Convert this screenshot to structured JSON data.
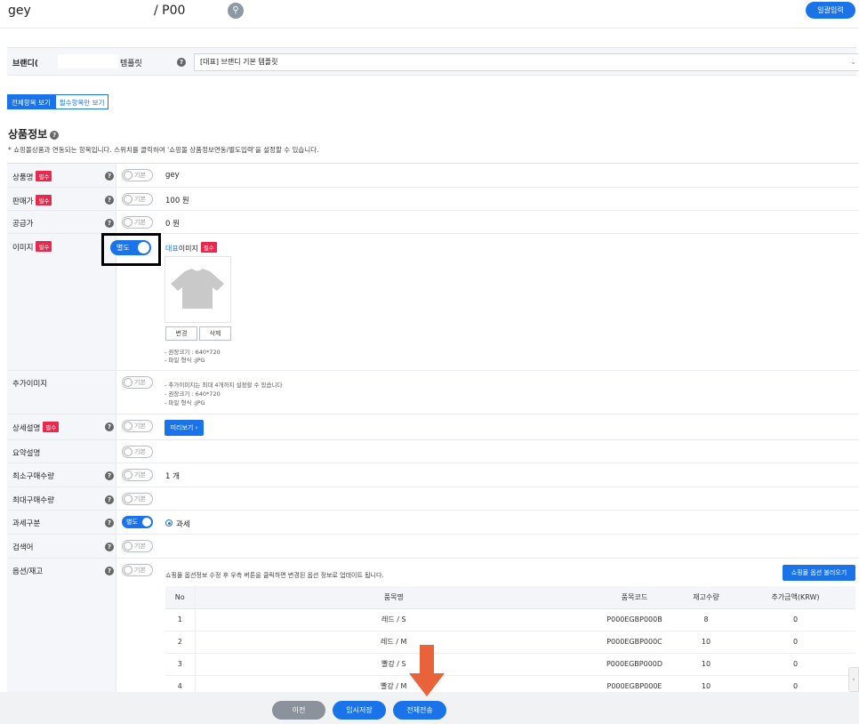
{
  "header": {
    "product_name": "gey",
    "product_code": "/ P00",
    "bulk_input_label": "일괄입력"
  },
  "brand_row": {
    "brand_label": "브랜디(",
    "template_label": "템플릿",
    "template_selected": "[대표] 브랜디 기본 템플릿"
  },
  "view_tabs": {
    "all_label": "전체항목 보기",
    "required_label": "필수항목만 보기"
  },
  "section": {
    "title": "상품정보",
    "description": "* 쇼핑몰상품과 연동되는 항목입니다. 스위치를 클릭하여 '쇼핑몰 상품정보연동/별도입력'을 설정할 수 있습니다."
  },
  "labels": {
    "required": "필수",
    "toggle_default": "기본",
    "toggle_separate": "별도"
  },
  "rows": {
    "product_name": {
      "label": "상품명",
      "value": "gey"
    },
    "sale_price": {
      "label": "판매가",
      "value": "100 원"
    },
    "supply_price": {
      "label": "공급가",
      "value": "0 원"
    },
    "image": {
      "label": "이미지",
      "rep_prefix": "대표",
      "rep_suffix": "이미지",
      "change_btn": "변경",
      "delete_btn": "삭제",
      "note_size": "- 권장크기 : 640*720",
      "note_format": "- 파일 형식 :JPG"
    },
    "extra_image": {
      "label": "추가이미지",
      "note_max": "- 추가이미지는 최대 4개까지 설정할 수 있습니다",
      "note_size": "- 권장크기 : 640*720",
      "note_format": "- 파일 형식 :JPG"
    },
    "detail_desc": {
      "label": "상세설명",
      "preview_btn": "미리보기 ›"
    },
    "summary_desc": {
      "label": "요약설명"
    },
    "min_qty": {
      "label": "최소구매수량",
      "value": "1 개"
    },
    "max_qty": {
      "label": "최대구매수량"
    },
    "tax": {
      "label": "과세구분",
      "option": "과세"
    },
    "keyword": {
      "label": "검색어"
    },
    "option_stock": {
      "label": "옵션/재고",
      "description": "쇼핑몰 옵션정보 수정 후 우측 버튼을 클릭하면 변경된 옵션 정보로 업데이트 됩니다.",
      "load_btn": "쇼핑몰 옵션 불러오기",
      "columns": [
        "No",
        "품목명",
        "품목코드",
        "재고수량",
        "추가금액(KRW)"
      ],
      "items": [
        {
          "no": "1",
          "name": "레드 / S",
          "code": "P000EGBP000B",
          "stock": "8",
          "extra": "0"
        },
        {
          "no": "2",
          "name": "레드 / M",
          "code": "P000EGBP000C",
          "stock": "10",
          "extra": "0"
        },
        {
          "no": "3",
          "name": "빨강 / S",
          "code": "P000EGBP000D",
          "stock": "10",
          "extra": "0"
        },
        {
          "no": "4",
          "name": "빨강 / M",
          "code": "P000EGBP000E",
          "stock": "10",
          "extra": "0"
        }
      ]
    }
  },
  "footer": {
    "prev_btn": "이전",
    "temp_save_btn": "임시저장",
    "send_all_btn": "전체전송"
  },
  "colors": {
    "accent": "#1a73e8",
    "required_badge": "#e8284c",
    "arrow": "#e8623a"
  }
}
